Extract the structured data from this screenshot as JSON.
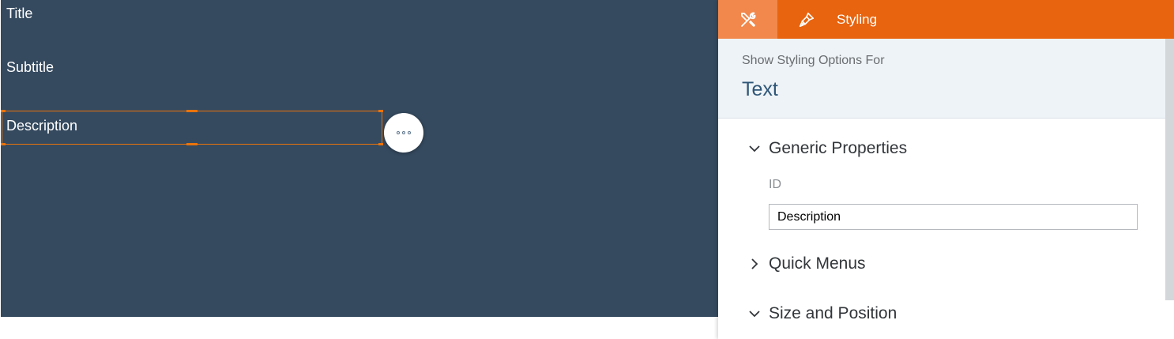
{
  "canvas": {
    "title": "Title",
    "subtitle": "Subtitle",
    "description": "Description",
    "more_button_icon": "ellipsis-icon"
  },
  "panel": {
    "tabs": {
      "builder_icon": "tools-icon",
      "styling_icon": "paint-brush-icon",
      "styling_label": "Styling"
    },
    "header": {
      "show_for_label": "Show Styling Options For",
      "type": "Text"
    },
    "sections": {
      "generic": {
        "label": "Generic Properties",
        "expanded": true,
        "id_label": "ID",
        "id_value": "Description"
      },
      "quick_menus": {
        "label": "Quick Menus",
        "expanded": false
      },
      "size_position": {
        "label": "Size and Position",
        "expanded": true
      }
    }
  },
  "colors": {
    "canvas_bg": "#354a5f",
    "accent": "#e8640f",
    "accent_light": "#f2884b",
    "panel_head_bg": "#eef3f7",
    "heading_blue": "#2f5677"
  }
}
